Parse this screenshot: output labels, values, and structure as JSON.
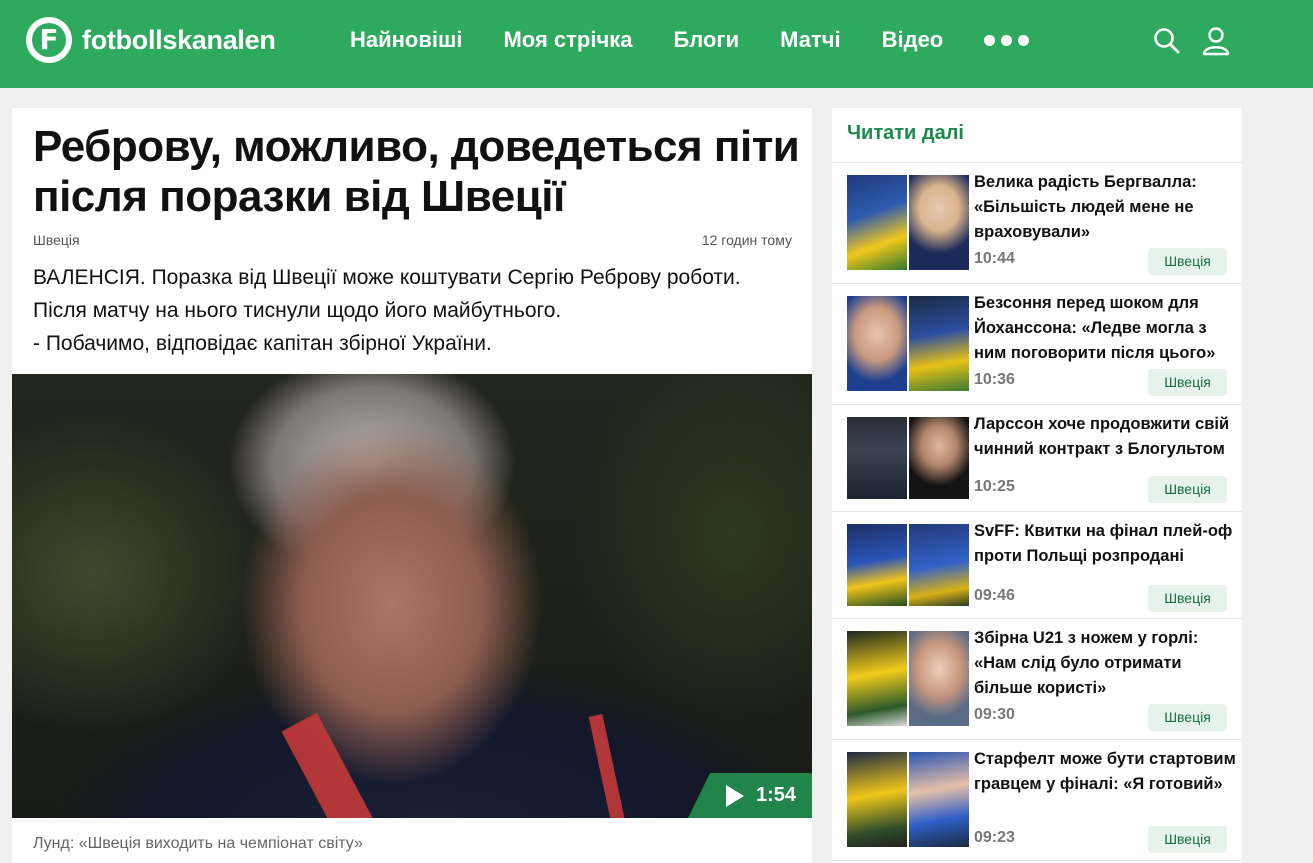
{
  "header": {
    "logo_letter": "F",
    "logo_text": "fotbollskanalen",
    "nav": [
      "Найновіші",
      "Моя стрічка",
      "Блоги",
      "Матчі",
      "Відео"
    ],
    "brand_color": "#2eaa5f",
    "icons": [
      "more-dots-icon",
      "search-icon",
      "user-icon"
    ]
  },
  "article": {
    "headline": "Реброву, можливо, доведеться піти після поразки від Швеції",
    "tag": "Швеція",
    "time": "12 годин тому",
    "lead": [
      "ВАЛЕНСІЯ. Поразка від Швеції може коштувати Сергію Реброву роботи.",
      "Після матчу на нього тиснули щодо його майбутнього.",
      "- Побачимо, відповідає капітан збірної України."
    ],
    "video_duration": "1:54",
    "caption": "Лунд: «Швеція виходить на чемпіонат світу»"
  },
  "sidebar": {
    "title": "Читати далі",
    "accent": "#1c8a4c",
    "items": [
      {
        "title": "Велика радість Бергвалла: «Більшість людей мене не враховували»",
        "time": "10:44",
        "tag": "Швеція"
      },
      {
        "title": "Безсоння перед шоком для Йоханссона: «Ледве могла з ним поговорити після цього»",
        "time": "10:36",
        "tag": "Швеція"
      },
      {
        "title": "Ларссон хоче продовжити свій чинний контракт з Блогультом",
        "time": "10:25",
        "tag": "Швеція"
      },
      {
        "title": "SvFF: Квитки на фінал плей-оф проти Польщі розпродані",
        "time": "09:46",
        "tag": "Швеція"
      },
      {
        "title": "Збірна U21 з ножем у горлі: «Нам слід було отримати більше користі»",
        "time": "09:30",
        "tag": "Швеція"
      },
      {
        "title": "Старфелт може бути стартовим гравцем у фіналі: «Я готовий»",
        "time": "09:23",
        "tag": "Швеція"
      }
    ]
  }
}
